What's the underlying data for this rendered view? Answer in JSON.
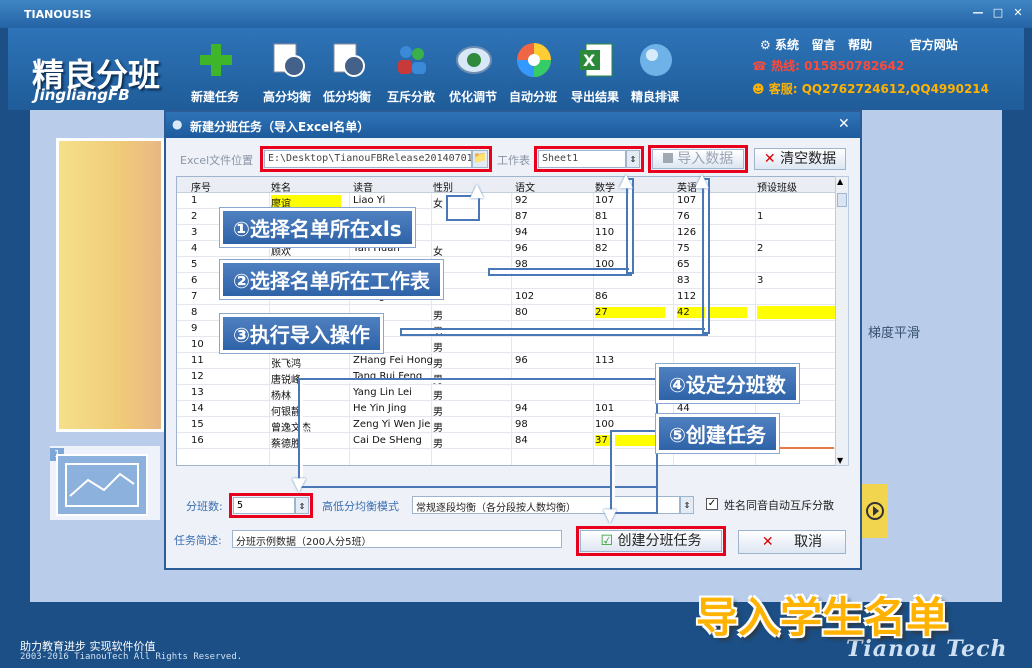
{
  "window": {
    "title": "TIANOUSIS",
    "min": "—",
    "restore": "□",
    "close": "✕"
  },
  "header": {
    "logo_cn": "精良分班",
    "logo_en": "JingliangFB",
    "toolbar": [
      {
        "label": "新建任务",
        "icon": "plus-icon"
      },
      {
        "label": "高分均衡",
        "icon": "document-clock-icon"
      },
      {
        "label": "低分均衡",
        "icon": "document-clock-icon"
      },
      {
        "label": "互斥分散",
        "icon": "people-icon"
      },
      {
        "label": "优化调节",
        "icon": "gauge-icon"
      },
      {
        "label": "自动分班",
        "icon": "color-wheel-icon"
      },
      {
        "label": "导出结果",
        "icon": "excel-icon"
      },
      {
        "label": "精良排课",
        "icon": "globe-icon"
      }
    ],
    "links": {
      "system": "系统",
      "message": "留言",
      "help": "帮助",
      "website": "官方网站"
    },
    "hotline_label": "热线:",
    "hotline": "015850782642",
    "service_label": "客服:",
    "service": "QQ2762724612,QQ4990214"
  },
  "side_label": "梯度平滑",
  "thumb_number": "1",
  "footer": {
    "line1": "助力教育进步  实现软件价值",
    "line2": "2003-2016 TianouTech All Rights Reserved.",
    "brand": "Tianou Tech"
  },
  "promo": "导入学生名单",
  "dialog": {
    "title": "新建分班任务（导入Excel名单）",
    "close": "✕",
    "excel_label": "Excel文件位置",
    "excel_path": "E:\\Desktop\\TianouFBRelease20140701",
    "sheet_label": "工作表",
    "sheet_value": "Sheet1",
    "import_button": "导入数据",
    "clear_button": "清空数据",
    "columns": [
      "序号",
      "姓名",
      "读音",
      "性别",
      "语文",
      "数学",
      "英语",
      "预设班级"
    ],
    "rows": [
      [
        "1",
        "廖谊",
        "Liao Yi",
        "女",
        "92",
        "107",
        "107",
        ""
      ],
      [
        "2",
        "",
        "",
        "",
        "87",
        "81",
        "76",
        "1"
      ],
      [
        "3",
        "",
        "",
        "",
        "94",
        "110",
        "126",
        ""
      ],
      [
        "4",
        "顾欢",
        "Yan Huan",
        "女",
        "96",
        "82",
        "75",
        "2"
      ],
      [
        "5",
        "",
        "",
        "",
        "98",
        "100",
        "65",
        ""
      ],
      [
        "6",
        "",
        "",
        "",
        "",
        "",
        "83",
        "3"
      ],
      [
        "7",
        "",
        "Zheng Shuo Ha",
        "",
        "102",
        "86",
        "112",
        ""
      ],
      [
        "8",
        "",
        "",
        "男",
        "80",
        "27",
        "42",
        ""
      ],
      [
        "9",
        "",
        "",
        "男",
        "",
        "",
        "",
        ""
      ],
      [
        "10",
        "",
        "",
        "男",
        "",
        "",
        "",
        ""
      ],
      [
        "11",
        "张飞鸿",
        "ZHang Fei Hong",
        "男",
        "96",
        "113",
        "",
        ""
      ],
      [
        "12",
        "唐锐峰",
        "Tang Rui Feng",
        "男",
        "",
        "",
        "",
        ""
      ],
      [
        "13",
        "杨林",
        "Yang Lin Lei",
        "男",
        "",
        "",
        "",
        ""
      ],
      [
        "14",
        "何银静",
        "He Yin Jing",
        "男",
        "94",
        "101",
        "44",
        ""
      ],
      [
        "15",
        "曾逸文杰",
        "Zeng Yi Wen Jie",
        "男",
        "98",
        "100",
        "",
        ""
      ],
      [
        "16",
        "蔡德胜",
        "Cai De SHeng",
        "男",
        "84",
        "37",
        "",
        ""
      ]
    ],
    "class_count_label": "分班数:",
    "class_count": "5",
    "mode_label": "高低分均衡模式",
    "mode_value": "常规逐段均衡（各分段按人数均衡）",
    "same_name_label": "姓名同音自动互斥分散",
    "desc_label": "任务简述:",
    "desc_value": "分班示例数据（200人分5班）",
    "create_button": "创建分班任务",
    "cancel_button": "取消"
  },
  "callouts": {
    "c1": "①选择名单所在xls",
    "c2": "②选择名单所在工作表",
    "c3": "③执行导入操作",
    "c4": "④设定分班数",
    "c5": "⑤创建任务"
  },
  "colors": {
    "accent_red": "#e8001c",
    "callout_blue": "#3a6db0",
    "highlight_yellow": "#ffff00",
    "promo_orange": "#ffb300"
  }
}
